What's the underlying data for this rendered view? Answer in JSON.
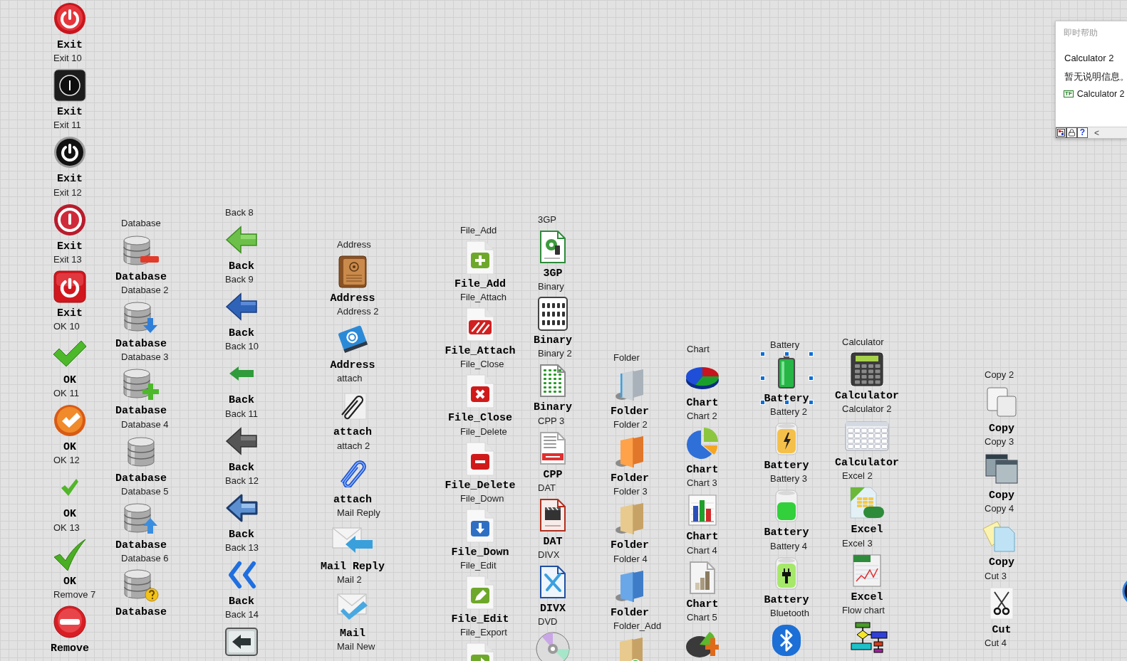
{
  "panel": {
    "columns": [
      {
        "controls": [
          {
            "kind": "power-red",
            "caption": "Exit",
            "selected": false
          },
          {
            "label": "Exit 10",
            "kind": "power-black-square",
            "caption": "Exit",
            "selected": false
          },
          {
            "label": "Exit 11",
            "kind": "power-black-round",
            "caption": "Exit",
            "selected": false
          },
          {
            "label": "Exit 12",
            "kind": "power-red-ring",
            "caption": "Exit",
            "selected": false
          },
          {
            "label": "Exit 13",
            "kind": "power-red-square",
            "caption": "Exit",
            "selected": false
          },
          {
            "label": "OK 10",
            "kind": "check-green",
            "caption": "OK",
            "selected": false
          },
          {
            "label": "OK 11",
            "kind": "check-orange",
            "caption": "OK",
            "selected": false
          },
          {
            "label": "OK 12",
            "kind": "check-small",
            "caption": "OK",
            "selected": false
          },
          {
            "label": "OK 13",
            "kind": "check-swoosh",
            "caption": "OK",
            "selected": false
          },
          {
            "label": "Remove 7",
            "kind": "minus-red",
            "caption": "Remove",
            "selected": false
          }
        ]
      },
      {
        "controls": [
          {
            "label": "Database",
            "kind": "db-minus",
            "caption": "Database",
            "selected": false
          },
          {
            "label": "Database 2",
            "kind": "db-down",
            "caption": "Database",
            "selected": false
          },
          {
            "label": "Database 3",
            "kind": "db-plus",
            "caption": "Database",
            "selected": false
          },
          {
            "label": "Database 4",
            "kind": "db-plain",
            "caption": "Database",
            "selected": false
          },
          {
            "label": "Database 5",
            "kind": "db-up",
            "caption": "Database",
            "selected": false
          },
          {
            "label": "Database 6",
            "kind": "db-question",
            "caption": "Database",
            "selected": false
          }
        ]
      },
      {
        "controls": [
          {
            "label": "Back 8",
            "kind": "arrow-green",
            "caption": "Back",
            "selected": false
          },
          {
            "label": "Back 9",
            "kind": "arrow-blue",
            "caption": "Back",
            "selected": false
          },
          {
            "label": "Back 10",
            "kind": "arrow-green-small",
            "caption": "Back",
            "selected": false
          },
          {
            "label": "Back 11",
            "kind": "arrow-grey",
            "caption": "Back",
            "selected": false
          },
          {
            "label": "Back 12",
            "kind": "arrow-blue-outline",
            "caption": "Back",
            "selected": false
          },
          {
            "label": "Back 13",
            "kind": "chevrons",
            "caption": "Back",
            "selected": false
          },
          {
            "label": "Back 14",
            "kind": "back-key",
            "selected": false
          }
        ]
      },
      {
        "controls": [
          {
            "label": "Address",
            "kind": "book-brown",
            "caption": "Address",
            "selected": false
          },
          {
            "label": "Address 2",
            "kind": "book-blue",
            "caption": "Address",
            "selected": false
          },
          {
            "label": "attach",
            "kind": "paperclip-paper",
            "caption": "attach",
            "selected": false
          },
          {
            "label": "attach 2",
            "kind": "paperclip-blue",
            "caption": "attach",
            "selected": false
          },
          {
            "label": "Mail Reply",
            "kind": "mail-reply",
            "caption": "Mail Reply",
            "selected": false
          },
          {
            "label": "Mail 2",
            "kind": "mail-check",
            "caption": "Mail",
            "selected": false
          },
          {
            "label": "Mail New"
          }
        ]
      },
      {
        "controls": [
          {
            "label": "File_Add",
            "kind": "file-plus",
            "caption": "File_Add",
            "selected": false
          },
          {
            "label": "File_Attach",
            "kind": "file-attach",
            "caption": "File_Attach",
            "selected": false
          },
          {
            "label": "File_Close",
            "kind": "file-close",
            "caption": "File_Close",
            "selected": false
          },
          {
            "label": "File_Delete",
            "kind": "file-minus",
            "caption": "File_Delete",
            "selected": false
          },
          {
            "label": "File_Down",
            "kind": "file-down",
            "caption": "File_Down",
            "selected": false
          },
          {
            "label": "File_Edit",
            "kind": "file-edit",
            "caption": "File_Edit",
            "selected": false
          },
          {
            "label": "File_Export",
            "kind": "file-export",
            "selected": false
          }
        ]
      },
      {
        "controls": [
          {
            "label": "3GP",
            "kind": "doc-3gp",
            "caption": "3GP",
            "selected": false
          },
          {
            "label": "Binary",
            "kind": "doc-binary",
            "caption": "Binary",
            "selected": false
          },
          {
            "label": "Binary 2",
            "kind": "doc-binary-green",
            "caption": "Binary",
            "selected": false
          },
          {
            "label": "CPP 3",
            "kind": "doc-cpp",
            "caption": "CPP",
            "selected": false
          },
          {
            "label": "DAT",
            "kind": "doc-dat",
            "caption": "DAT",
            "selected": false
          },
          {
            "label": "DIVX",
            "kind": "doc-divx",
            "caption": "DIVX",
            "selected": false
          },
          {
            "label": "DVD",
            "kind": "disc-dvd",
            "selected": false
          }
        ]
      },
      {
        "controls": [
          {
            "label": "Folder",
            "kind": "folder-grey",
            "caption": "Folder",
            "selected": false
          },
          {
            "label": "Folder 2",
            "kind": "folder-orange",
            "caption": "Folder",
            "selected": false
          },
          {
            "label": "Folder 3",
            "kind": "folder-tan",
            "caption": "Folder",
            "selected": false
          },
          {
            "label": "Folder 4",
            "kind": "folder-blue",
            "caption": "Folder",
            "selected": false
          },
          {
            "label": "Folder_Add",
            "kind": "folder-add",
            "selected": false
          }
        ]
      },
      {
        "controls": [
          {
            "label": "Chart",
            "kind": "pie-3d",
            "caption": "Chart",
            "selected": false
          },
          {
            "label": "Chart 2",
            "kind": "pie",
            "caption": "Chart",
            "selected": false
          },
          {
            "label": "Chart 3",
            "kind": "bar-chart",
            "caption": "Chart",
            "selected": false
          },
          {
            "label": "Chart 4",
            "kind": "chart-doc",
            "caption": "Chart",
            "selected": false
          },
          {
            "label": "Chart 5",
            "kind": "pie-plus",
            "selected": false
          }
        ]
      },
      {
        "controls": [
          {
            "label": "Battery",
            "kind": "battery-green",
            "caption": "Battery",
            "selected": true
          },
          {
            "label": "Battery 2",
            "kind": "battery-bolt",
            "caption": "Battery",
            "selected": false
          },
          {
            "label": "Battery 3",
            "kind": "battery-glass",
            "caption": "Battery",
            "selected": false
          },
          {
            "label": "Battery 4",
            "kind": "battery-plug",
            "caption": "Battery",
            "selected": false
          },
          {
            "label": "Bluetooth",
            "kind": "bluetooth",
            "selected": false
          }
        ]
      },
      {
        "controls": [
          {
            "label": "Calculator",
            "kind": "calculator",
            "caption": "Calculator",
            "selected": false
          },
          {
            "label": "Calculator 2",
            "kind": "calculator-window",
            "caption": "Calculator",
            "selected": false
          },
          {
            "label": "Excel 2",
            "kind": "excel-xls",
            "caption": "Excel",
            "selected": false
          },
          {
            "label": "Excel 3",
            "kind": "excel-chart",
            "caption": "Excel",
            "selected": false
          },
          {
            "label": "Flow chart",
            "kind": "flowchart",
            "selected": false
          }
        ]
      },
      {
        "controls": [
          {
            "label": "Copy 2",
            "kind": "copy-pages",
            "caption": "Copy",
            "selected": false
          },
          {
            "label": "Copy 3",
            "kind": "copy-panels",
            "caption": "Copy",
            "selected": false
          },
          {
            "label": "Copy 4",
            "kind": "copy-notes",
            "caption": "Copy",
            "selected": false
          },
          {
            "label": "Cut 3",
            "kind": "scissors",
            "caption": "Cut",
            "selected": false
          },
          {
            "label": "Cut 4"
          }
        ]
      }
    ]
  },
  "context_help": {
    "title": "即时帮助",
    "heading": "Calculator 2",
    "description": "暂无说明信息。",
    "terminal": {
      "type": "TF",
      "name": "Calculator 2"
    },
    "help_button": "?",
    "collapse_button": "<"
  }
}
